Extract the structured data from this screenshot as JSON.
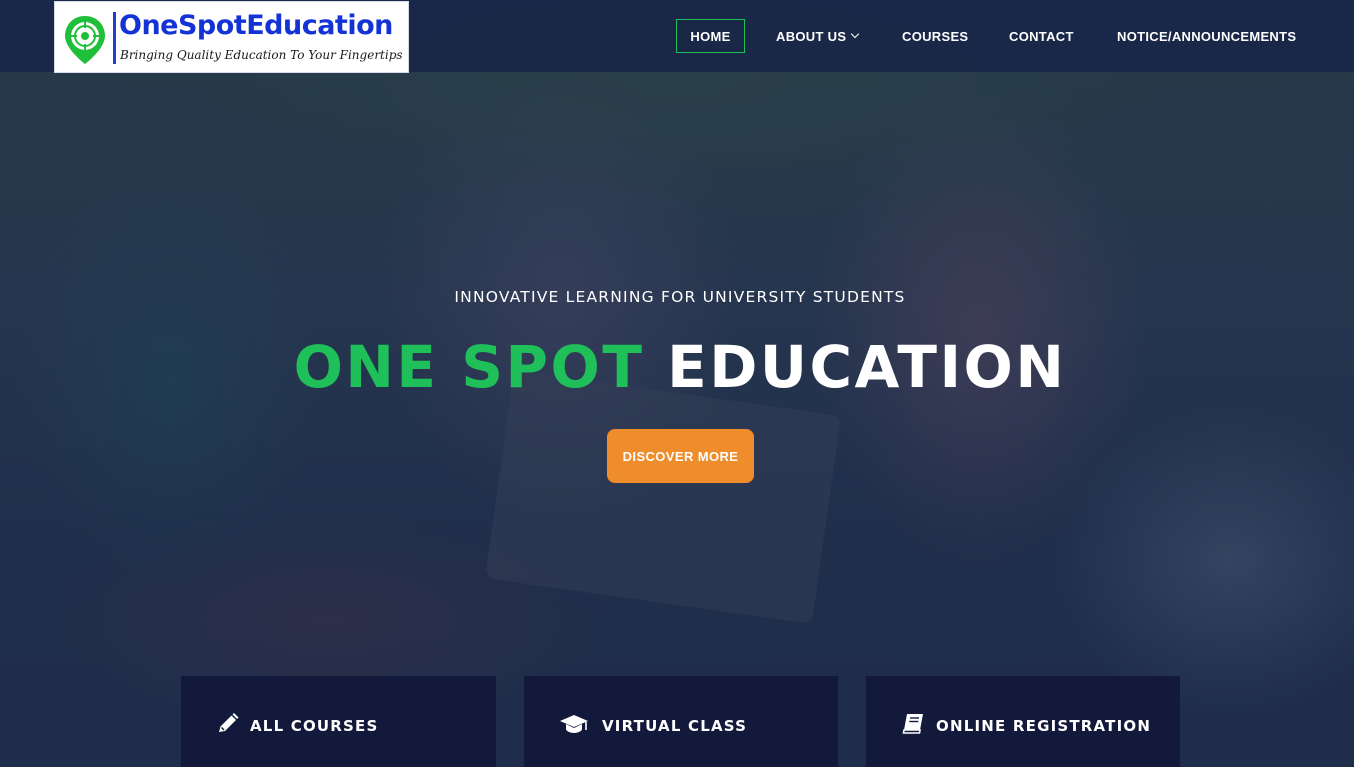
{
  "brand": {
    "name": "OneSpotEducation",
    "tagline": "Bringing Quality Education To Your Fingertips",
    "colors": {
      "blue": "#1433d6",
      "green": "#1fc05a"
    }
  },
  "nav": {
    "items": [
      {
        "label": "HOME",
        "active": true
      },
      {
        "label": "ABOUT US",
        "has_dropdown": true
      },
      {
        "label": "COURSES"
      },
      {
        "label": "CONTACT"
      },
      {
        "label": "NOTICE/ANNOUNCEMENTS"
      }
    ]
  },
  "hero": {
    "subtitle": "INNOVATIVE LEARNING FOR UNIVERSITY STUDENTS",
    "title_green": "ONE SPOT",
    "title_white": "EDUCATION",
    "cta_label": "DISCOVER MORE",
    "cta_color": "#ef8c2b"
  },
  "features": [
    {
      "icon": "pencil-icon",
      "label": "ALL COURSES"
    },
    {
      "icon": "graduation-cap-icon",
      "label": "VIRTUAL CLASS"
    },
    {
      "icon": "book-icon",
      "label": "ONLINE REGISTRATION"
    }
  ]
}
